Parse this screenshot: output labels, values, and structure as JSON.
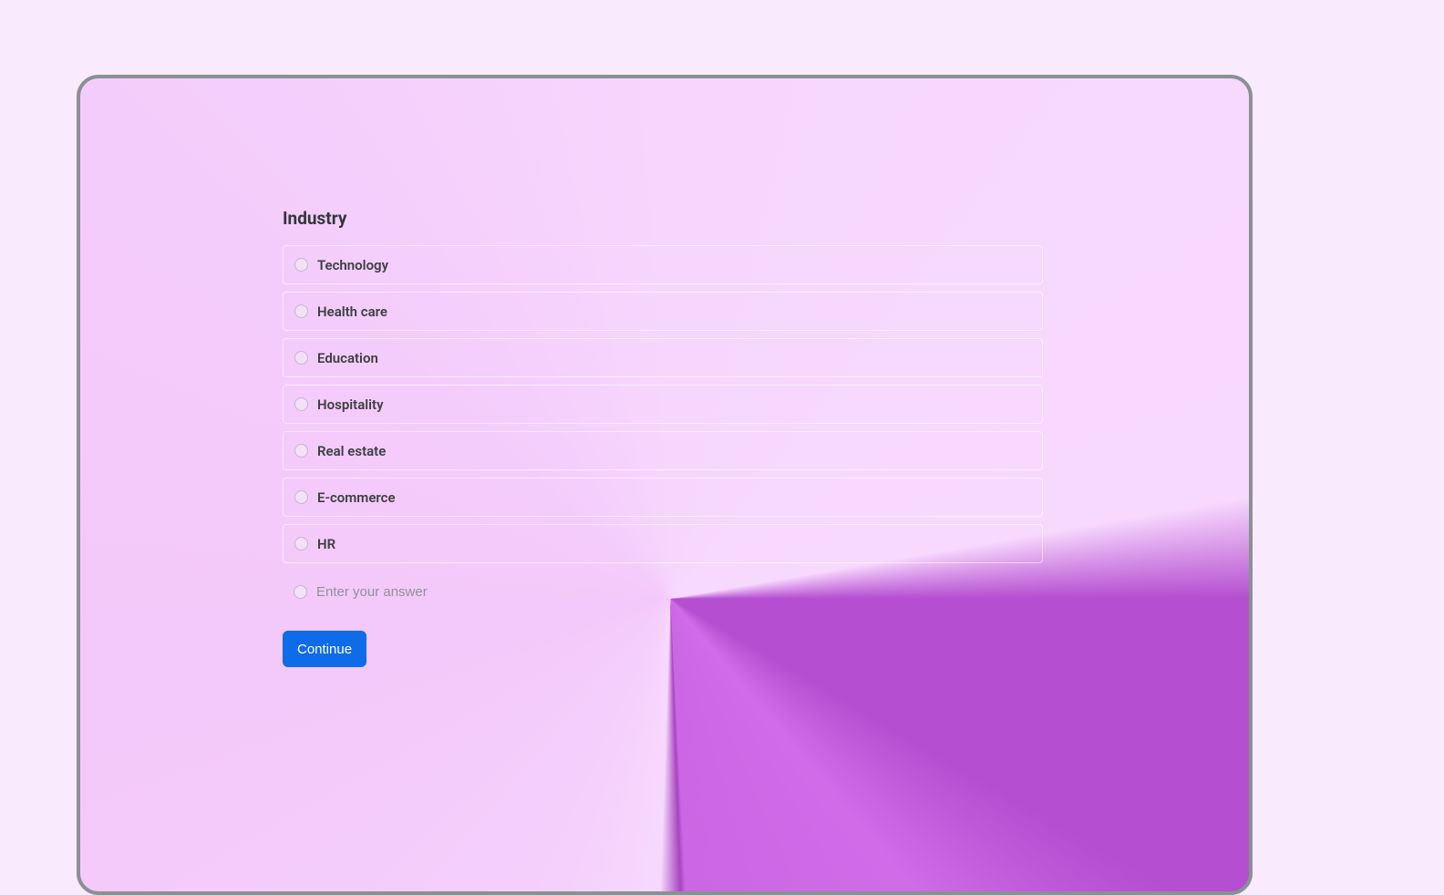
{
  "form": {
    "title": "Industry",
    "options": [
      "Technology",
      "Health care",
      "Education",
      "Hospitality",
      "Real estate",
      "E-commerce",
      "HR"
    ],
    "other_placeholder": "Enter your answer",
    "continue_label": "Continue"
  }
}
